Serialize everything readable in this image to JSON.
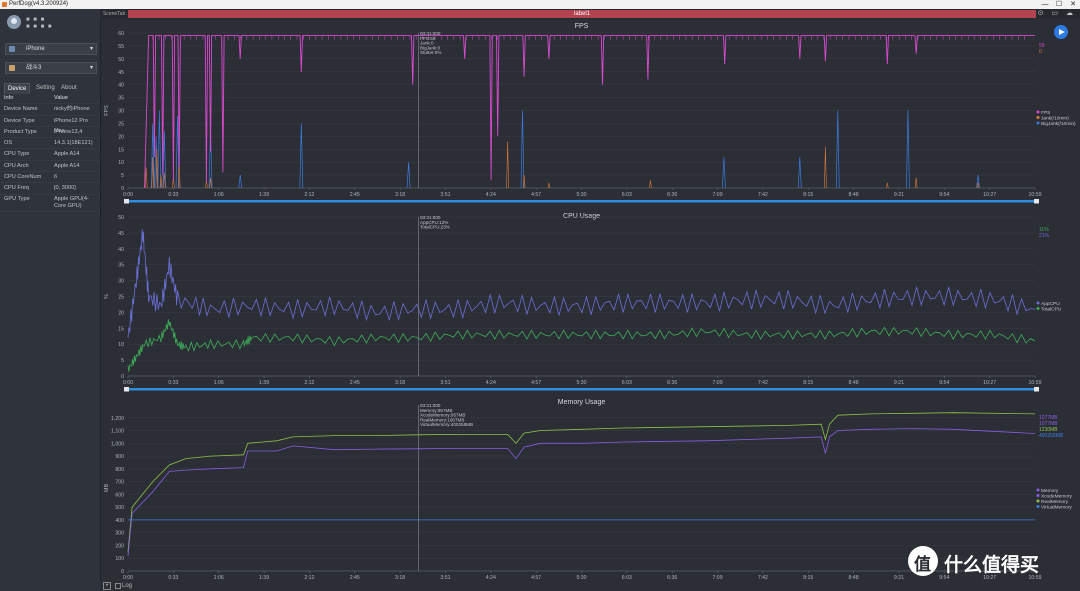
{
  "window": {
    "title": "PerfDog(v4.3.200924)",
    "minimize": "—",
    "maximize": "☐",
    "close": "✕"
  },
  "sidebar": {
    "user_name": "■ ■ ■",
    "user_sub": "■ ■ ■ ■",
    "device_select": "iPhone",
    "app_select": "战斗3",
    "tabs": [
      "Device",
      "Setting",
      "About"
    ],
    "active_tab": "Device",
    "info_header": {
      "key": "Info",
      "value": "Value"
    },
    "info_rows": [
      {
        "key": "Device Name",
        "value": "nicky的iPhone"
      },
      {
        "key": "Device Type",
        "value": "iPhone12 Pro Max"
      },
      {
        "key": "Product Type",
        "value": "iPhone13,4"
      },
      {
        "key": "OS",
        "value": "14.3.1(18E121)"
      },
      {
        "key": "CPU Type",
        "value": "Apple A14"
      },
      {
        "key": "CPU Arch",
        "value": "Apple A14"
      },
      {
        "key": "CPU CoreNum",
        "value": "6"
      },
      {
        "key": "CPU Freq",
        "value": "[0, 3000]"
      },
      {
        "key": "GPU Type",
        "value": "Apple GPU(4-Core GPU)"
      }
    ]
  },
  "toolbar": {
    "scene_label": "SceneTab",
    "label_bar": "label1",
    "icons": [
      "location-icon",
      "folder-icon",
      "cloud-icon"
    ],
    "icon_glyphs": "⊙ ▭ ☁"
  },
  "footer": {
    "plus": "+",
    "log_label": "Log"
  },
  "watermark": {
    "text": "什么值得买"
  },
  "colors": {
    "fps": "#d94ad0",
    "jank": "#3c7be0",
    "appcpu": "#6b6fd6",
    "totalcpu": "#3fae5a",
    "memory": "#8a5ce0",
    "xcode": "#8a5ce0",
    "real": "#8dc24a",
    "virtual": "#3c7be0",
    "marker": "#8a8e98"
  },
  "chart_data": [
    {
      "type": "line",
      "title": "FPS",
      "ylabel": "FPS",
      "ylim": [
        0,
        60
      ],
      "yticks": [
        0,
        5,
        10,
        15,
        20,
        25,
        30,
        35,
        40,
        45,
        50,
        55,
        60
      ],
      "xticks": [
        "0:00",
        "0:33",
        "1:06",
        "1:39",
        "2:12",
        "2:45",
        "3:18",
        "3:51",
        "4:24",
        "4:57",
        "5:30",
        "6:03",
        "6:36",
        "7:09",
        "7:42",
        "8:15",
        "8:48",
        "9:21",
        "9:54",
        "10:27",
        "10:59"
      ],
      "cursor_tooltip": [
        "03:31:000",
        "FPS:59",
        "Jank:0",
        "BigJank:0",
        "Stutter:0%"
      ],
      "legend": [
        "FPS",
        "Jank(/10min)",
        "BigJank(/10min)"
      ],
      "legend_values": [
        "59",
        "0"
      ],
      "series": [
        {
          "name": "FPS",
          "baseline": 59,
          "dips": [
            [
              0.32,
              12
            ],
            [
              0.42,
              5
            ],
            [
              0.55,
              3
            ],
            [
              0.62,
              8
            ],
            [
              0.95,
              2
            ],
            [
              1.0,
              14
            ],
            [
              1.15,
              6
            ],
            [
              1.36,
              50
            ],
            [
              2.1,
              45
            ],
            [
              3.45,
              40
            ],
            [
              4.08,
              50
            ],
            [
              4.4,
              3
            ],
            [
              4.48,
              20
            ],
            [
              4.8,
              43
            ],
            [
              5.1,
              50
            ],
            [
              5.75,
              40
            ],
            [
              6.3,
              42
            ],
            [
              7.23,
              48
            ],
            [
              8.14,
              50
            ],
            [
              8.45,
              49
            ],
            [
              9.2,
              48
            ],
            [
              9.55,
              52
            ]
          ]
        },
        {
          "name": "Jank",
          "spikes": [
            [
              0.22,
              8
            ],
            [
              0.3,
              12
            ],
            [
              0.35,
              15
            ],
            [
              0.4,
              5
            ],
            [
              0.44,
              6
            ],
            [
              0.55,
              4
            ],
            [
              0.62,
              10
            ],
            [
              0.95,
              3
            ],
            [
              1.0,
              4
            ],
            [
              4.6,
              18
            ],
            [
              4.8,
              5
            ],
            [
              5.1,
              2
            ],
            [
              6.33,
              3
            ],
            [
              8.45,
              16
            ],
            [
              9.2,
              2
            ],
            [
              9.55,
              4
            ],
            [
              10.3,
              2
            ]
          ]
        },
        {
          "name": "BigJank",
          "spikes": [
            [
              0.3,
              25
            ],
            [
              0.34,
              20
            ],
            [
              0.38,
              30
            ],
            [
              0.44,
              22
            ],
            [
              0.6,
              28
            ],
            [
              1.0,
              24
            ],
            [
              1.36,
              5
            ],
            [
              2.1,
              25
            ],
            [
              3.4,
              10
            ],
            [
              4.78,
              30
            ],
            [
              7.22,
              12
            ],
            [
              8.14,
              12
            ],
            [
              8.6,
              30
            ],
            [
              9.45,
              30
            ],
            [
              10.3,
              5
            ]
          ]
        }
      ]
    },
    {
      "type": "line",
      "title": "CPU Usage",
      "ylabel": "%",
      "ylim": [
        0,
        50
      ],
      "yticks": [
        0,
        5,
        10,
        15,
        20,
        25,
        30,
        35,
        40,
        45,
        50
      ],
      "xticks": [
        "0:00",
        "0:33",
        "1:06",
        "1:39",
        "2:12",
        "2:45",
        "3:18",
        "3:51",
        "4:24",
        "4:57",
        "5:30",
        "6:03",
        "6:36",
        "7:09",
        "7:42",
        "8:15",
        "8:48",
        "9:21",
        "9:54",
        "10:27",
        "10:59"
      ],
      "cursor_tooltip": [
        "03:31:000",
        "AppCPU:12%",
        "TotalCPU:23%"
      ],
      "legend": [
        "AppCPU",
        "TotalCPU"
      ],
      "legend_values": [
        "11%",
        "21%"
      ],
      "series": [
        {
          "name": "TotalCPU",
          "points": [
            [
              0.0,
              12
            ],
            [
              0.1,
              30
            ],
            [
              0.18,
              45
            ],
            [
              0.25,
              25
            ],
            [
              0.4,
              22
            ],
            [
              0.5,
              35
            ],
            [
              0.6,
              24
            ],
            [
              1.0,
              21
            ],
            [
              1.5,
              22
            ],
            [
              2.0,
              21
            ],
            [
              2.5,
              22
            ],
            [
              3.0,
              20
            ],
            [
              3.5,
              21
            ],
            [
              4.0,
              21
            ],
            [
              4.5,
              23
            ],
            [
              5.0,
              22
            ],
            [
              5.5,
              22
            ],
            [
              6.0,
              23
            ],
            [
              6.5,
              23
            ],
            [
              7.0,
              23
            ],
            [
              7.5,
              24
            ],
            [
              8.0,
              24
            ],
            [
              8.5,
              22
            ],
            [
              9.0,
              24
            ],
            [
              9.5,
              25
            ],
            [
              10.0,
              25
            ],
            [
              10.5,
              24
            ],
            [
              10.99,
              21
            ]
          ]
        },
        {
          "name": "AppCPU",
          "points": [
            [
              0.0,
              2
            ],
            [
              0.1,
              6
            ],
            [
              0.2,
              10
            ],
            [
              0.4,
              12
            ],
            [
              0.5,
              17
            ],
            [
              0.6,
              10
            ],
            [
              0.7,
              9
            ],
            [
              1.0,
              10
            ],
            [
              1.4,
              10
            ],
            [
              1.5,
              12
            ],
            [
              2.0,
              12
            ],
            [
              2.5,
              11
            ],
            [
              3.0,
              12
            ],
            [
              3.5,
              12
            ],
            [
              4.0,
              13
            ],
            [
              4.5,
              13
            ],
            [
              5.0,
              13
            ],
            [
              5.5,
              13
            ],
            [
              6.0,
              13
            ],
            [
              6.5,
              13
            ],
            [
              7.0,
              14
            ],
            [
              7.5,
              13
            ],
            [
              8.0,
              13
            ],
            [
              8.5,
              13
            ],
            [
              9.0,
              14
            ],
            [
              9.5,
              14
            ],
            [
              10.0,
              13
            ],
            [
              10.5,
              13
            ],
            [
              10.99,
              11
            ]
          ]
        }
      ]
    },
    {
      "type": "line",
      "title": "Memory Usage",
      "ylabel": "MB",
      "ylim": [
        0,
        1300
      ],
      "yticks": [
        0,
        100,
        200,
        300,
        400,
        500,
        600,
        700,
        800,
        900,
        1000,
        1100,
        1200
      ],
      "ytick_labels": [
        "0",
        "100",
        "200",
        "300",
        "400",
        "500",
        "600",
        "700",
        "800",
        "900",
        "1,000",
        "1,100",
        "1,200"
      ],
      "xticks": [
        "0:00",
        "0:33",
        "1:06",
        "1:39",
        "2:12",
        "2:45",
        "3:18",
        "3:51",
        "4:24",
        "4:57",
        "5:30",
        "6:03",
        "6:36",
        "7:09",
        "7:42",
        "8:15",
        "8:48",
        "9:21",
        "9:54",
        "10:27",
        "10:59"
      ],
      "cursor_tooltip": [
        "03:31:000",
        "Memory:957MB",
        "XcodeMemory:957MB",
        "RealMemory:1067MB",
        "VirtualMemory:400258MB"
      ],
      "legend": [
        "Memory",
        "XcodeMemory",
        "RealMemory",
        "VirtualMemory"
      ],
      "legend_values": [
        "1077MB",
        "1077MB",
        "1230MB",
        "400258MB"
      ],
      "series": [
        {
          "name": "RealMemory",
          "points": [
            [
              0.0,
              150
            ],
            [
              0.05,
              500
            ],
            [
              0.15,
              580
            ],
            [
              0.3,
              700
            ],
            [
              0.5,
              830
            ],
            [
              0.7,
              880
            ],
            [
              1.0,
              900
            ],
            [
              1.4,
              910
            ],
            [
              1.45,
              1000
            ],
            [
              1.8,
              1020
            ],
            [
              2.0,
              1050
            ],
            [
              2.5,
              1060
            ],
            [
              3.0,
              1060
            ],
            [
              3.5,
              1067
            ],
            [
              4.0,
              1070
            ],
            [
              4.6,
              1070
            ],
            [
              4.7,
              1000
            ],
            [
              4.8,
              1080
            ],
            [
              5.0,
              1100
            ],
            [
              5.5,
              1110
            ],
            [
              6.0,
              1120
            ],
            [
              7.0,
              1130
            ],
            [
              8.0,
              1140
            ],
            [
              8.4,
              1150
            ],
            [
              8.45,
              1030
            ],
            [
              8.5,
              1150
            ],
            [
              8.6,
              1220
            ],
            [
              9.0,
              1230
            ],
            [
              9.5,
              1235
            ],
            [
              10.0,
              1240
            ],
            [
              10.99,
              1230
            ]
          ]
        },
        {
          "name": "Memory",
          "points": [
            [
              0.0,
              120
            ],
            [
              0.05,
              450
            ],
            [
              0.15,
              520
            ],
            [
              0.3,
              620
            ],
            [
              0.5,
              780
            ],
            [
              0.7,
              790
            ],
            [
              1.0,
              800
            ],
            [
              1.4,
              810
            ],
            [
              1.45,
              940
            ],
            [
              1.8,
              940
            ],
            [
              2.0,
              980
            ],
            [
              2.5,
              950
            ],
            [
              3.0,
              955
            ],
            [
              3.5,
              957
            ],
            [
              4.0,
              960
            ],
            [
              4.6,
              960
            ],
            [
              4.7,
              880
            ],
            [
              4.8,
              970
            ],
            [
              5.0,
              1000
            ],
            [
              5.5,
              1000
            ],
            [
              6.0,
              1010
            ],
            [
              7.0,
              1020
            ],
            [
              8.0,
              1040
            ],
            [
              8.4,
              1050
            ],
            [
              8.45,
              920
            ],
            [
              8.5,
              1050
            ],
            [
              8.6,
              1100
            ],
            [
              9.0,
              1110
            ],
            [
              9.5,
              1115
            ],
            [
              10.0,
              1110
            ],
            [
              10.99,
              1077
            ]
          ]
        },
        {
          "name": "VirtualMemory",
          "points": [
            [
              0.0,
              400
            ],
            [
              10.99,
              400
            ]
          ]
        }
      ]
    }
  ]
}
